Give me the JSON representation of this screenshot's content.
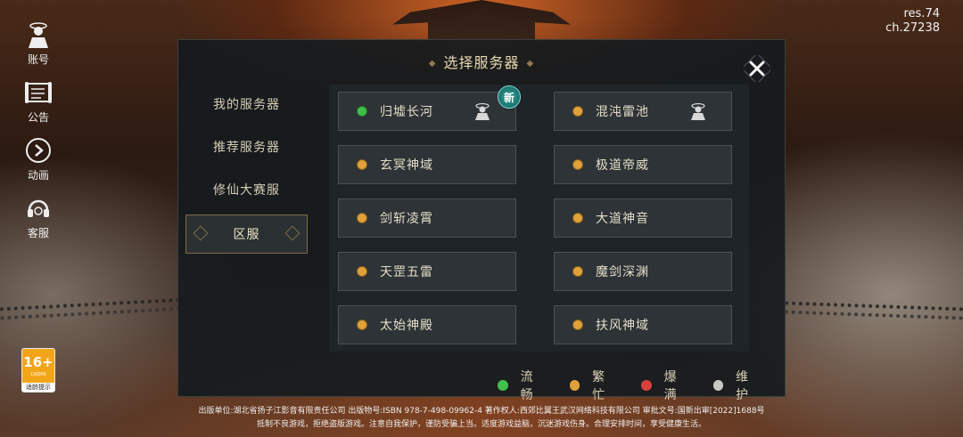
{
  "res_info": {
    "res": "res.74",
    "ch": "ch.27238"
  },
  "side_menu": [
    {
      "label": "账号",
      "icon": "account-icon"
    },
    {
      "label": "公告",
      "icon": "announcement-icon"
    },
    {
      "label": "动画",
      "icon": "play-icon"
    },
    {
      "label": "客服",
      "icon": "customer-service-icon"
    }
  ],
  "age_badge": {
    "age": "16+",
    "org": "CADPA",
    "tip": "适龄提示"
  },
  "panel": {
    "title": "选择服务器",
    "tabs": [
      {
        "label": "我的服务器",
        "active": false
      },
      {
        "label": "推荐服务器",
        "active": false
      },
      {
        "label": "修仙大赛服",
        "active": false
      },
      {
        "label": "区服",
        "active": true
      }
    ],
    "servers": [
      {
        "name": "归墟长河",
        "status": "green",
        "has_role": true,
        "new_label": "新"
      },
      {
        "name": "混沌雷池",
        "status": "orange",
        "has_role": true,
        "new_label": ""
      },
      {
        "name": "玄冥神域",
        "status": "orange",
        "has_role": false,
        "new_label": ""
      },
      {
        "name": "极道帝威",
        "status": "orange",
        "has_role": false,
        "new_label": ""
      },
      {
        "name": "剑斩凌霄",
        "status": "orange",
        "has_role": false,
        "new_label": ""
      },
      {
        "name": "大道神音",
        "status": "orange",
        "has_role": false,
        "new_label": ""
      },
      {
        "name": "天罡五雷",
        "status": "orange",
        "has_role": false,
        "new_label": ""
      },
      {
        "name": "魔剑深渊",
        "status": "orange",
        "has_role": false,
        "new_label": ""
      },
      {
        "name": "太始神殿",
        "status": "orange",
        "has_role": false,
        "new_label": ""
      },
      {
        "name": "扶风神域",
        "status": "orange",
        "has_role": false,
        "new_label": ""
      }
    ],
    "legend": [
      {
        "label": "流畅",
        "color": "#3fbf4a"
      },
      {
        "label": "繁忙",
        "color": "#e0a03a"
      },
      {
        "label": "爆满",
        "color": "#d84040"
      },
      {
        "label": "维护",
        "color": "#c8c8c0"
      }
    ]
  },
  "status_colors": {
    "green": "#3fbf4a",
    "orange": "#e0a03a",
    "red": "#d84040",
    "gray": "#c8c8c0"
  },
  "footer": {
    "line1": "出版单位:湖北省扬子江影音有限责任公司 出版物号:ISBN 978-7-498-09962-4 著作权人:西郊比翼王武汉网络科技有限公司 审批文号:国新出审[2022]1688号",
    "line2": "抵制不良游戏，拒绝盗版游戏。注意自我保护，谨防受骗上当。适度游戏益脑，沉迷游戏伤身。合理安排时间，享受健康生活。"
  }
}
